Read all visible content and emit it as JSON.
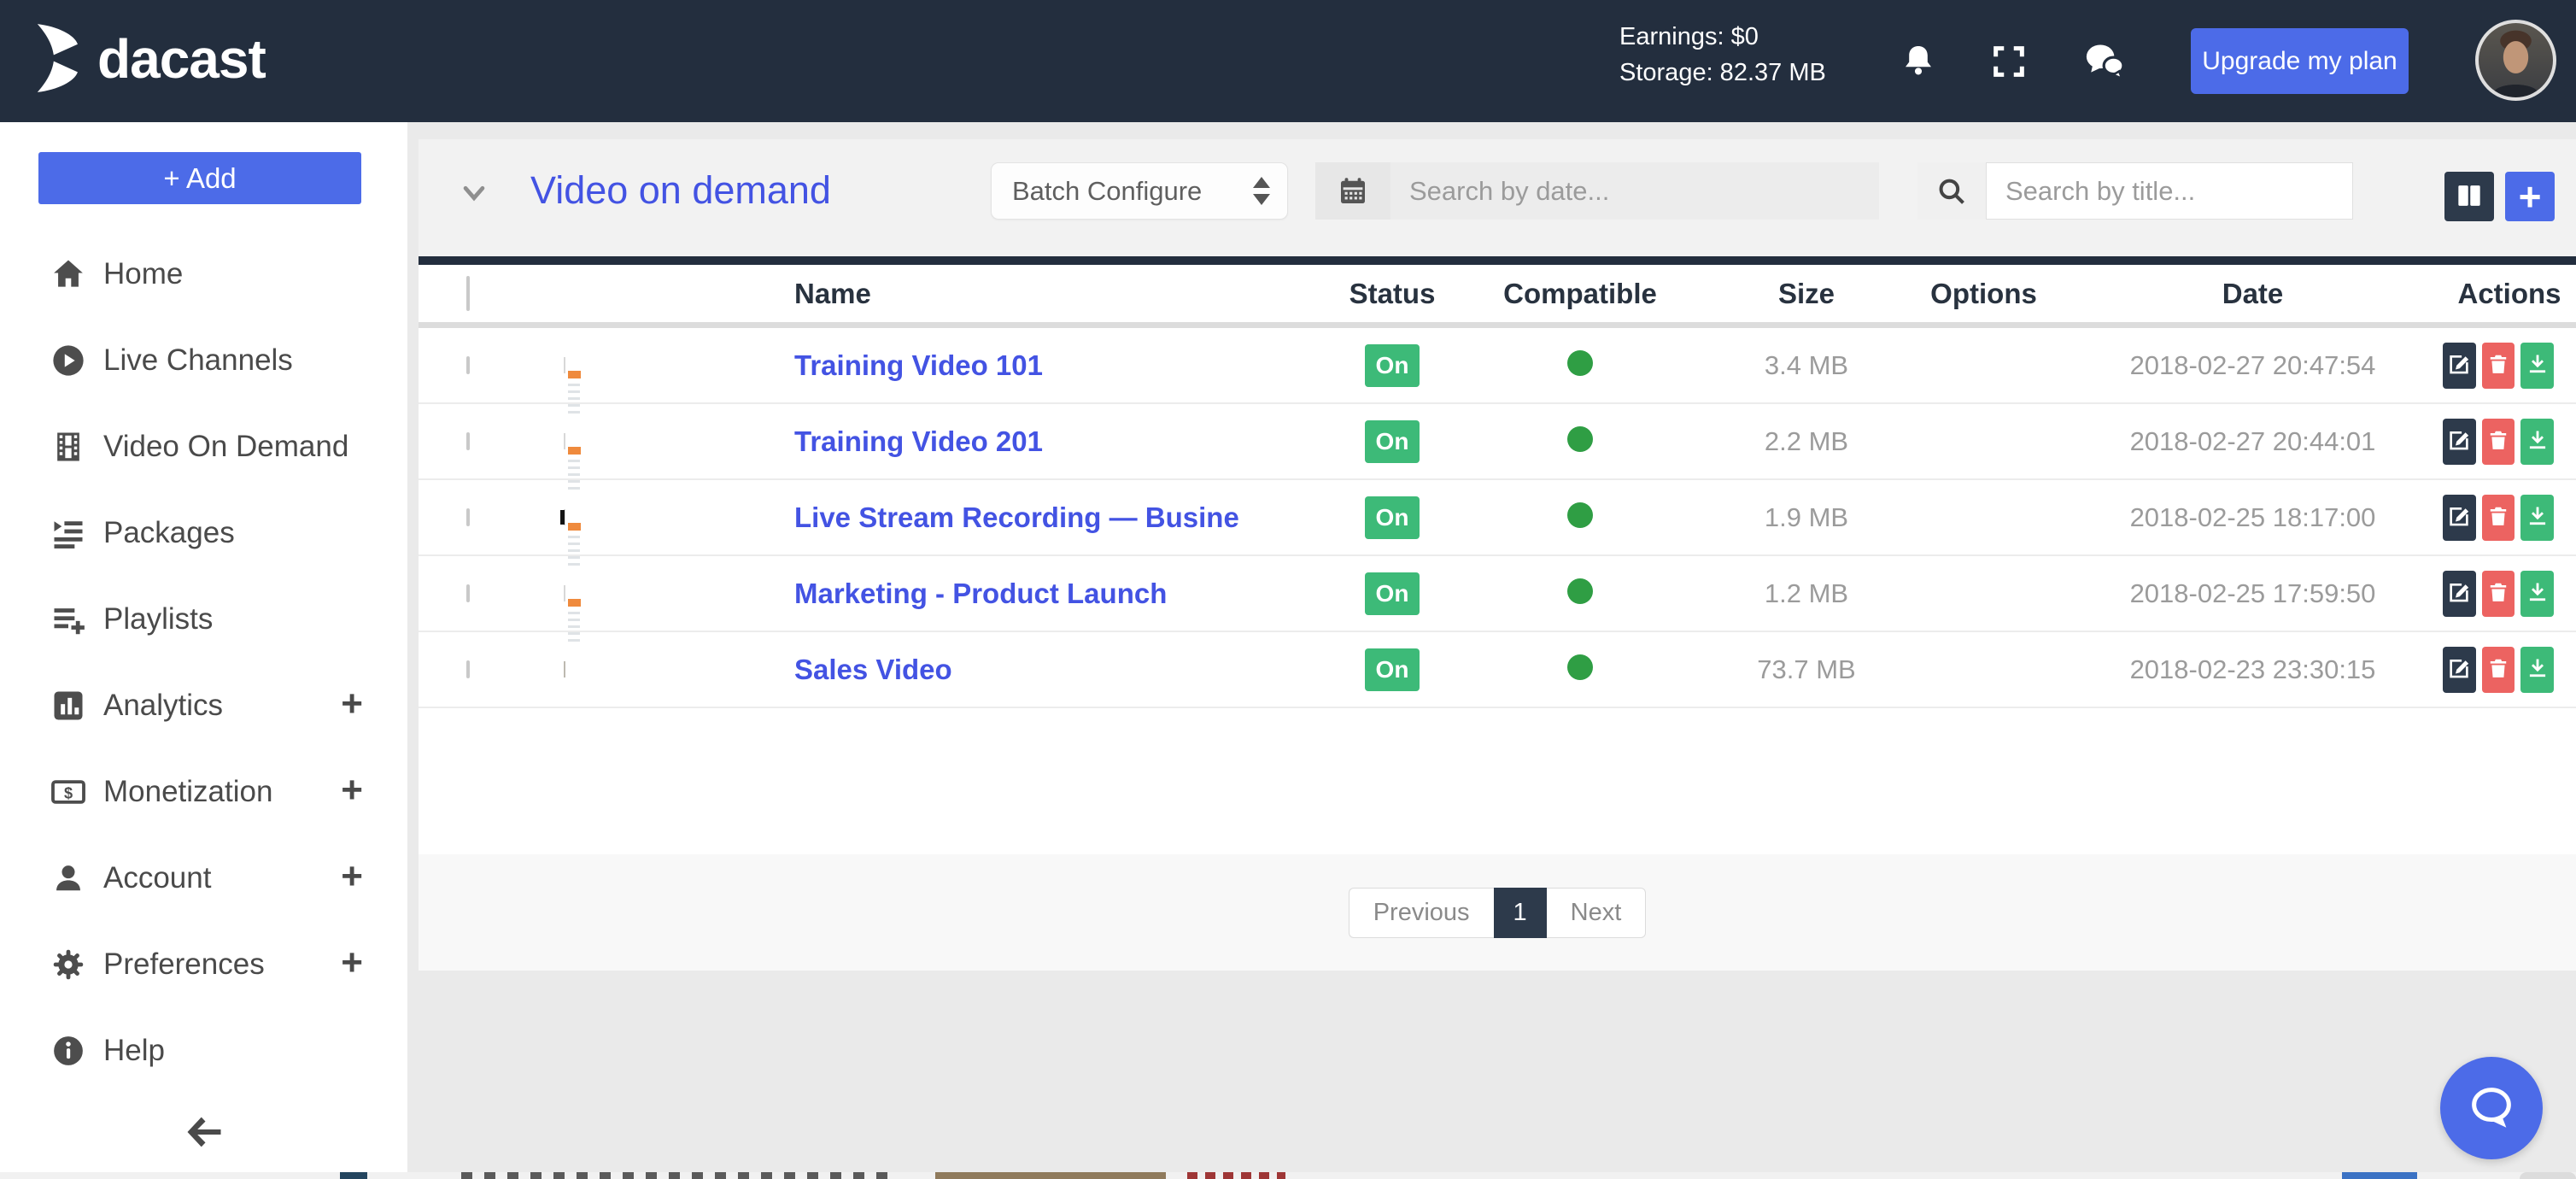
{
  "header": {
    "logo_text": "dacast",
    "earnings": "Earnings: $0",
    "storage": "Storage: 82.37 MB",
    "upgrade_label": "Upgrade my plan"
  },
  "sidebar": {
    "add_label": "+ Add",
    "items": [
      {
        "label": "Home",
        "icon": "home",
        "expandable": false
      },
      {
        "label": "Live Channels",
        "icon": "play-circle",
        "expandable": false
      },
      {
        "label": "Video On Demand",
        "icon": "film",
        "expandable": false
      },
      {
        "label": "Packages",
        "icon": "indent-list",
        "expandable": false
      },
      {
        "label": "Playlists",
        "icon": "playlist-add",
        "expandable": false
      },
      {
        "label": "Analytics",
        "icon": "bar-chart",
        "expandable": true
      },
      {
        "label": "Monetization",
        "icon": "dollar",
        "expandable": true
      },
      {
        "label": "Account",
        "icon": "person",
        "expandable": true
      },
      {
        "label": "Preferences",
        "icon": "gear",
        "expandable": true
      },
      {
        "label": "Help",
        "icon": "info",
        "expandable": false
      }
    ],
    "expand_glyph": "+"
  },
  "toolbar": {
    "title": "Video on demand",
    "batch_select_value": "Batch Configure",
    "date_placeholder": "Search by date...",
    "title_placeholder": "Search by title...",
    "plus_button_glyph": "+"
  },
  "table": {
    "columns": [
      "Name",
      "Status",
      "Compatible",
      "Size",
      "Options",
      "Date",
      "Actions"
    ],
    "rows": [
      {
        "name": "Training Video 101",
        "status": "On",
        "compatible": true,
        "size": "3.4 MB",
        "options": "",
        "date": "2018-02-27 20:47:54",
        "thumbnail": "dashboard-a"
      },
      {
        "name": "Training Video 201",
        "status": "On",
        "compatible": true,
        "size": "2.2 MB",
        "options": "",
        "date": "2018-02-27 20:44:01",
        "thumbnail": "dashboard-b"
      },
      {
        "name": "Live Stream Recording — Busine",
        "status": "On",
        "compatible": true,
        "size": "1.9 MB",
        "options": "",
        "date": "2018-02-25 18:17:00",
        "thumbnail": "dashboard-c"
      },
      {
        "name": "Marketing - Product Launch",
        "status": "On",
        "compatible": true,
        "size": "1.2 MB",
        "options": "",
        "date": "2018-02-25 17:59:50",
        "thumbnail": "dashboard-d"
      },
      {
        "name": "Sales Video",
        "status": "On",
        "compatible": true,
        "size": "73.7 MB",
        "options": "",
        "date": "2018-02-23 23:30:15",
        "thumbnail": "crowd"
      }
    ]
  },
  "pagination": {
    "previous": "Previous",
    "current": "1",
    "next": "Next"
  },
  "colors": {
    "header_dark": "#232e3e",
    "accent_blue": "#4c6be8",
    "link_blue": "#4353e3",
    "badge_green": "#3dba78",
    "dot_green": "#2f9e44",
    "delete_red": "#ec6361",
    "navy_button": "#2d3a4b",
    "muted_text": "#9b9b9b"
  }
}
